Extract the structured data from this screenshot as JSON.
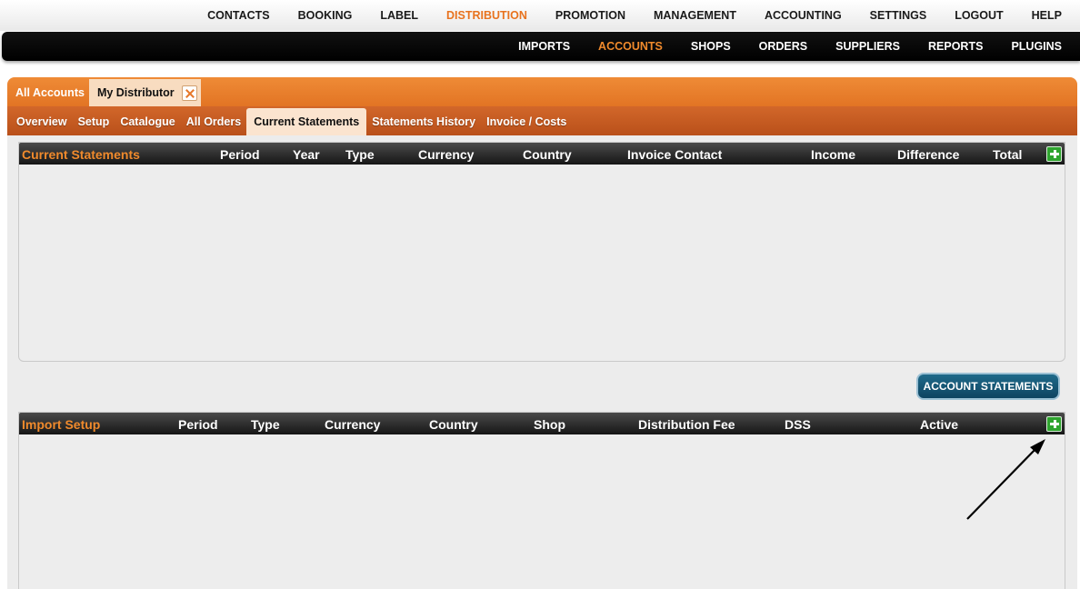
{
  "top_nav": [
    {
      "label": "CONTACTS",
      "active": false
    },
    {
      "label": "BOOKING",
      "active": false
    },
    {
      "label": "LABEL",
      "active": false
    },
    {
      "label": "DISTRIBUTION",
      "active": true
    },
    {
      "label": "PROMOTION",
      "active": false
    },
    {
      "label": "MANAGEMENT",
      "active": false
    },
    {
      "label": "ACCOUNTING",
      "active": false
    },
    {
      "label": "SETTINGS",
      "active": false
    },
    {
      "label": "LOGOUT",
      "active": false
    },
    {
      "label": "HELP",
      "active": false
    }
  ],
  "sub_nav": [
    {
      "label": "IMPORTS",
      "active": false
    },
    {
      "label": "ACCOUNTS",
      "active": true
    },
    {
      "label": "SHOPS",
      "active": false
    },
    {
      "label": "ORDERS",
      "active": false
    },
    {
      "label": "SUPPLIERS",
      "active": false
    },
    {
      "label": "REPORTS",
      "active": false
    },
    {
      "label": "PLUGINS",
      "active": false
    }
  ],
  "tabs": {
    "all_accounts": "All Accounts",
    "my_distributor": "My Distributor",
    "close_icon": "close-icon"
  },
  "sub_tabs": [
    {
      "label": "Overview",
      "active": false
    },
    {
      "label": "Setup",
      "active": false
    },
    {
      "label": "Catalogue",
      "active": false
    },
    {
      "label": "All Orders",
      "active": false
    },
    {
      "label": "Current Statements",
      "active": true
    },
    {
      "label": "Statements History",
      "active": false
    },
    {
      "label": "Invoice / Costs",
      "active": false
    }
  ],
  "current_statements": {
    "title": "Current Statements",
    "columns": [
      "Period",
      "Year",
      "Type",
      "Currency",
      "Country",
      "Invoice Contact",
      "Income",
      "Difference",
      "Total"
    ]
  },
  "account_statements_button": "ACCOUNT STATEMENTS",
  "import_setup": {
    "title": "Import Setup",
    "columns": [
      "Period",
      "Type",
      "Currency",
      "Country",
      "Shop",
      "Distribution Fee",
      "DSS",
      "Active"
    ]
  },
  "colors": {
    "accent_orange": "#f08a2c",
    "tab_orange": "#e8782a",
    "button_blue": "#0e4461",
    "add_green": "#2fa42f"
  }
}
